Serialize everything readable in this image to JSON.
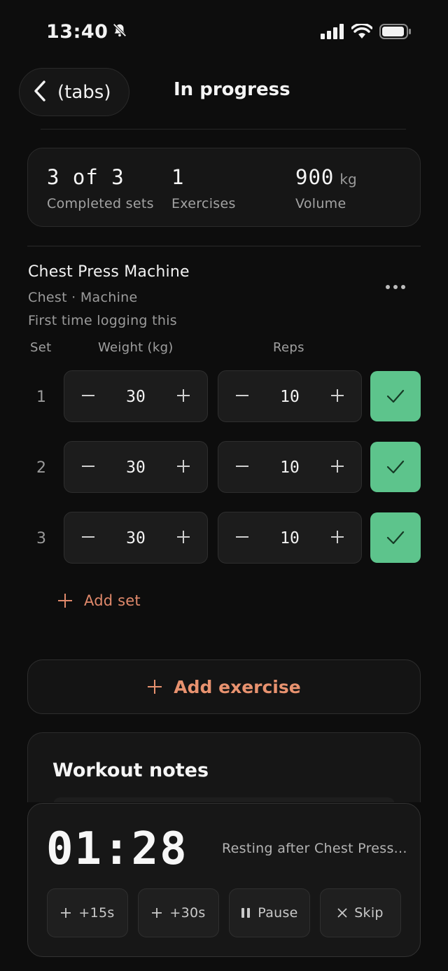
{
  "status_bar": {
    "time": "13:40",
    "icons": [
      "bell-slash-icon",
      "cellular-signal-icon",
      "wifi-icon",
      "battery-icon"
    ]
  },
  "nav": {
    "back_label": "(tabs)",
    "title": "In progress"
  },
  "summary": {
    "completed_sets_value": "3 of 3",
    "completed_sets_label": "Completed sets",
    "exercises_value": "1",
    "exercises_label": "Exercises",
    "volume_value": "900",
    "volume_unit": "kg",
    "volume_label": "Volume"
  },
  "exercise": {
    "name": "Chest Press Machine",
    "meta": "Chest · Machine",
    "note": "First time logging this",
    "columns": {
      "set": "Set",
      "weight": "Weight (kg)",
      "reps": "Reps"
    },
    "sets": [
      {
        "num": "1",
        "weight": "30",
        "reps": "10",
        "done": true
      },
      {
        "num": "2",
        "weight": "30",
        "reps": "10",
        "done": true
      },
      {
        "num": "3",
        "weight": "30",
        "reps": "10",
        "done": true
      }
    ],
    "add_set_label": "Add set"
  },
  "add_exercise_label": "Add exercise",
  "notes": {
    "title": "Workout notes"
  },
  "rest_timer": {
    "time": "01:28",
    "status": "Resting after Chest Press...",
    "buttons": {
      "plus15": "+15s",
      "plus30": "+30s",
      "pause": "Pause",
      "skip": "Skip"
    }
  },
  "colors": {
    "background": "#0d0d0d",
    "accent": "#e8926f",
    "check_green": "#5dc48c"
  }
}
